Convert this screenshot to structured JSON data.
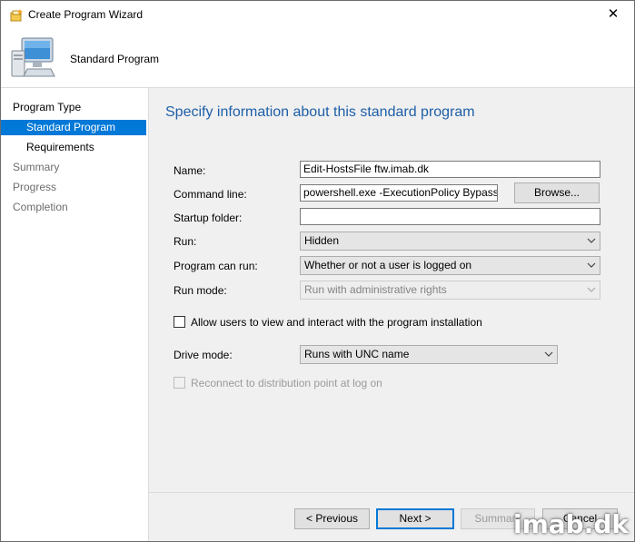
{
  "window": {
    "title": "Create Program Wizard",
    "close_glyph": "✕"
  },
  "header": {
    "title": "Standard Program"
  },
  "nav": {
    "items": [
      {
        "label": "Program Type",
        "state": "normal"
      },
      {
        "label": "Standard Program",
        "state": "active"
      },
      {
        "label": "Requirements",
        "state": "normal"
      },
      {
        "label": "Summary",
        "state": "inactive"
      },
      {
        "label": "Progress",
        "state": "inactive"
      },
      {
        "label": "Completion",
        "state": "inactive"
      }
    ]
  },
  "main": {
    "heading": "Specify information about this standard program",
    "name": {
      "label": "Name:",
      "value": "Edit-HostsFile ftw.imab.dk"
    },
    "command_line": {
      "label": "Command line:",
      "value": "powershell.exe -ExecutionPolicy Bypass -NoL",
      "browse_label": "Browse..."
    },
    "startup_folder": {
      "label": "Startup folder:",
      "value": ""
    },
    "run": {
      "label": "Run:",
      "value": "Hidden"
    },
    "program_can_run": {
      "label": "Program can run:",
      "value": "Whether or not a user is logged on"
    },
    "run_mode": {
      "label": "Run mode:",
      "value": "Run with administrative rights"
    },
    "allow_interact": {
      "label": "Allow users to view and interact with the program installation",
      "checked": false
    },
    "drive_mode": {
      "label": "Drive mode:",
      "value": "Runs with UNC name"
    },
    "reconnect": {
      "label": "Reconnect to distribution point at log on",
      "checked": false
    }
  },
  "footer": {
    "previous_label": "< Previous",
    "next_label": "Next >",
    "summary_label": "Summary",
    "cancel_label": "Cancel"
  },
  "watermark": "imab.dk",
  "colors": {
    "accent": "#0078d7",
    "heading": "#1e5fa8"
  }
}
